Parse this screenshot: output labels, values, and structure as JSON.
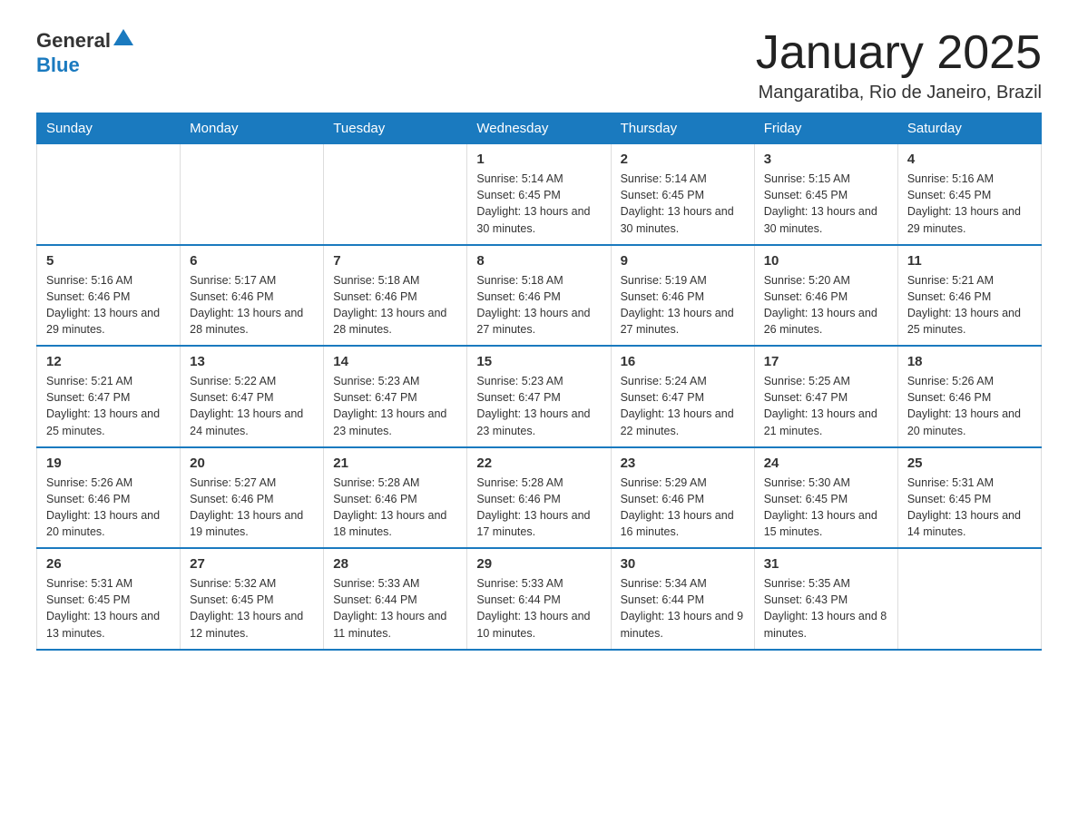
{
  "logo": {
    "general": "General",
    "blue": "Blue"
  },
  "title": "January 2025",
  "subtitle": "Mangaratiba, Rio de Janeiro, Brazil",
  "days_of_week": [
    "Sunday",
    "Monday",
    "Tuesday",
    "Wednesday",
    "Thursday",
    "Friday",
    "Saturday"
  ],
  "weeks": [
    [
      {
        "day": "",
        "info": ""
      },
      {
        "day": "",
        "info": ""
      },
      {
        "day": "",
        "info": ""
      },
      {
        "day": "1",
        "info": "Sunrise: 5:14 AM\nSunset: 6:45 PM\nDaylight: 13 hours and 30 minutes."
      },
      {
        "day": "2",
        "info": "Sunrise: 5:14 AM\nSunset: 6:45 PM\nDaylight: 13 hours and 30 minutes."
      },
      {
        "day": "3",
        "info": "Sunrise: 5:15 AM\nSunset: 6:45 PM\nDaylight: 13 hours and 30 minutes."
      },
      {
        "day": "4",
        "info": "Sunrise: 5:16 AM\nSunset: 6:45 PM\nDaylight: 13 hours and 29 minutes."
      }
    ],
    [
      {
        "day": "5",
        "info": "Sunrise: 5:16 AM\nSunset: 6:46 PM\nDaylight: 13 hours and 29 minutes."
      },
      {
        "day": "6",
        "info": "Sunrise: 5:17 AM\nSunset: 6:46 PM\nDaylight: 13 hours and 28 minutes."
      },
      {
        "day": "7",
        "info": "Sunrise: 5:18 AM\nSunset: 6:46 PM\nDaylight: 13 hours and 28 minutes."
      },
      {
        "day": "8",
        "info": "Sunrise: 5:18 AM\nSunset: 6:46 PM\nDaylight: 13 hours and 27 minutes."
      },
      {
        "day": "9",
        "info": "Sunrise: 5:19 AM\nSunset: 6:46 PM\nDaylight: 13 hours and 27 minutes."
      },
      {
        "day": "10",
        "info": "Sunrise: 5:20 AM\nSunset: 6:46 PM\nDaylight: 13 hours and 26 minutes."
      },
      {
        "day": "11",
        "info": "Sunrise: 5:21 AM\nSunset: 6:46 PM\nDaylight: 13 hours and 25 minutes."
      }
    ],
    [
      {
        "day": "12",
        "info": "Sunrise: 5:21 AM\nSunset: 6:47 PM\nDaylight: 13 hours and 25 minutes."
      },
      {
        "day": "13",
        "info": "Sunrise: 5:22 AM\nSunset: 6:47 PM\nDaylight: 13 hours and 24 minutes."
      },
      {
        "day": "14",
        "info": "Sunrise: 5:23 AM\nSunset: 6:47 PM\nDaylight: 13 hours and 23 minutes."
      },
      {
        "day": "15",
        "info": "Sunrise: 5:23 AM\nSunset: 6:47 PM\nDaylight: 13 hours and 23 minutes."
      },
      {
        "day": "16",
        "info": "Sunrise: 5:24 AM\nSunset: 6:47 PM\nDaylight: 13 hours and 22 minutes."
      },
      {
        "day": "17",
        "info": "Sunrise: 5:25 AM\nSunset: 6:47 PM\nDaylight: 13 hours and 21 minutes."
      },
      {
        "day": "18",
        "info": "Sunrise: 5:26 AM\nSunset: 6:46 PM\nDaylight: 13 hours and 20 minutes."
      }
    ],
    [
      {
        "day": "19",
        "info": "Sunrise: 5:26 AM\nSunset: 6:46 PM\nDaylight: 13 hours and 20 minutes."
      },
      {
        "day": "20",
        "info": "Sunrise: 5:27 AM\nSunset: 6:46 PM\nDaylight: 13 hours and 19 minutes."
      },
      {
        "day": "21",
        "info": "Sunrise: 5:28 AM\nSunset: 6:46 PM\nDaylight: 13 hours and 18 minutes."
      },
      {
        "day": "22",
        "info": "Sunrise: 5:28 AM\nSunset: 6:46 PM\nDaylight: 13 hours and 17 minutes."
      },
      {
        "day": "23",
        "info": "Sunrise: 5:29 AM\nSunset: 6:46 PM\nDaylight: 13 hours and 16 minutes."
      },
      {
        "day": "24",
        "info": "Sunrise: 5:30 AM\nSunset: 6:45 PM\nDaylight: 13 hours and 15 minutes."
      },
      {
        "day": "25",
        "info": "Sunrise: 5:31 AM\nSunset: 6:45 PM\nDaylight: 13 hours and 14 minutes."
      }
    ],
    [
      {
        "day": "26",
        "info": "Sunrise: 5:31 AM\nSunset: 6:45 PM\nDaylight: 13 hours and 13 minutes."
      },
      {
        "day": "27",
        "info": "Sunrise: 5:32 AM\nSunset: 6:45 PM\nDaylight: 13 hours and 12 minutes."
      },
      {
        "day": "28",
        "info": "Sunrise: 5:33 AM\nSunset: 6:44 PM\nDaylight: 13 hours and 11 minutes."
      },
      {
        "day": "29",
        "info": "Sunrise: 5:33 AM\nSunset: 6:44 PM\nDaylight: 13 hours and 10 minutes."
      },
      {
        "day": "30",
        "info": "Sunrise: 5:34 AM\nSunset: 6:44 PM\nDaylight: 13 hours and 9 minutes."
      },
      {
        "day": "31",
        "info": "Sunrise: 5:35 AM\nSunset: 6:43 PM\nDaylight: 13 hours and 8 minutes."
      },
      {
        "day": "",
        "info": ""
      }
    ]
  ]
}
